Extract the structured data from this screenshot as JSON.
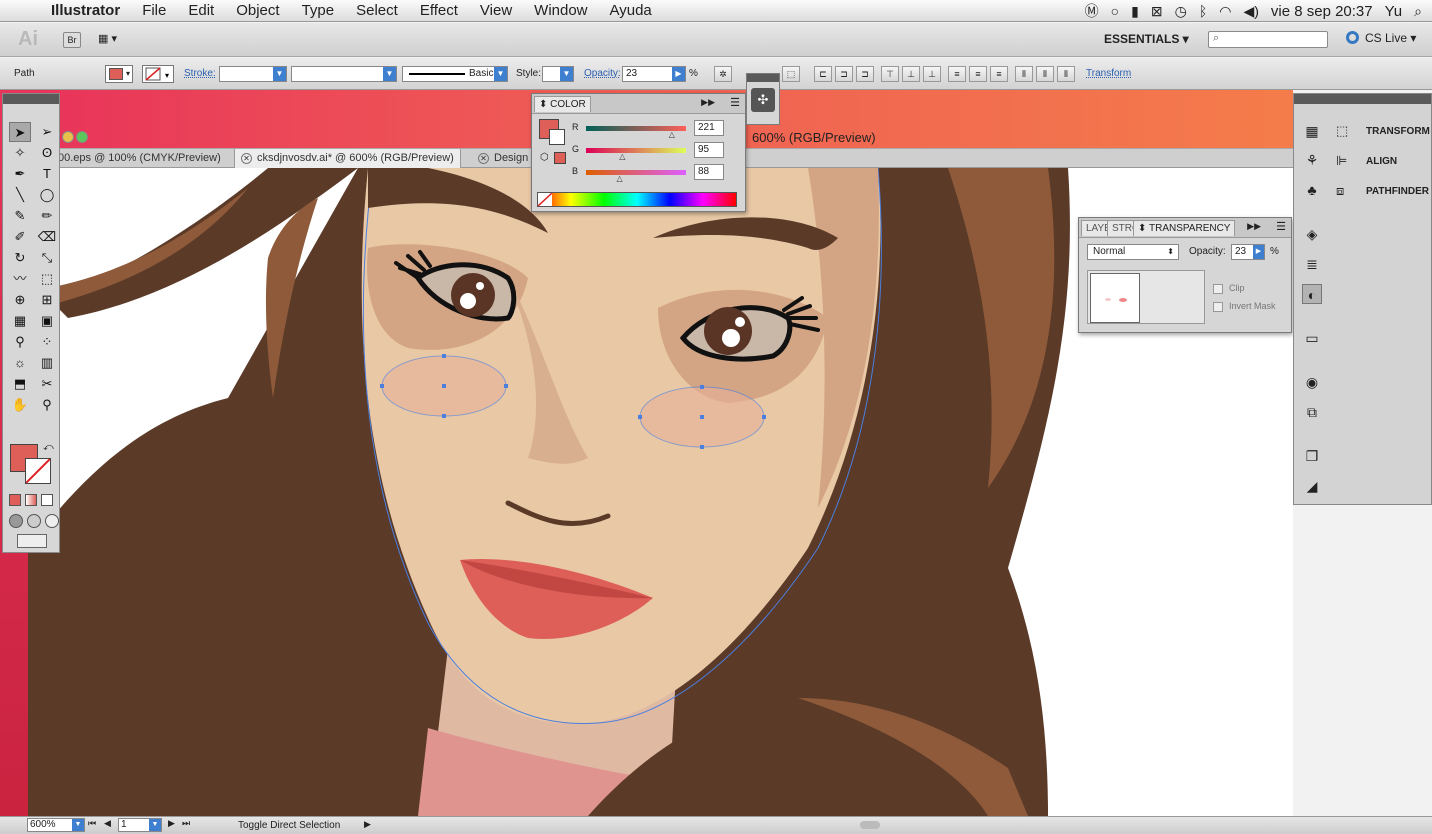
{
  "menubar": {
    "apple_icon": "apple-icon",
    "app_name": "Illustrator",
    "items": [
      "File",
      "Edit",
      "Object",
      "Type",
      "Select",
      "Effect",
      "View",
      "Window",
      "Ayuda"
    ],
    "clock": "vie 8 sep  20:37",
    "user": "Yu"
  },
  "appbar": {
    "logo": "Ai",
    "bridge": "Br",
    "workspace": "ESSENTIALS ▾",
    "search_placeholder": "",
    "cs_live": "CS Live ▾"
  },
  "control": {
    "selection_type": "Path",
    "stroke_label": "Stroke:",
    "brush_label": "Basic",
    "style_label": "Style:",
    "opacity_label": "Opacity:",
    "opacity_value": "23",
    "percent": "%",
    "transform_link": "Transform"
  },
  "tabs": [
    {
      "label": "00.eps @ 100% (CMYK/Preview)"
    },
    {
      "label": "cksdjnvosdv.ai* @ 600% (RGB/Preview)"
    },
    {
      "label": "Design"
    }
  ],
  "window_title_fragment": "600% (RGB/Preview)",
  "color_panel": {
    "title": "COLOR",
    "channels": [
      {
        "name": "R",
        "value": "221",
        "fraction": 0.867
      },
      {
        "name": "G",
        "value": "95",
        "fraction": 0.373
      },
      {
        "name": "B",
        "value": "88",
        "fraction": 0.345
      }
    ],
    "fill_color": "#dd5f58"
  },
  "transparency_panel": {
    "tabs": [
      "LAYE",
      "STRO",
      "TRANSPARENCY"
    ],
    "blend_mode": "Normal",
    "opacity_label": "Opacity:",
    "opacity_value": "23",
    "percent": "%",
    "clip_label": "Clip",
    "invert_mask_label": "Invert Mask"
  },
  "dock": {
    "items": [
      "TRANSFORM",
      "ALIGN",
      "PATHFINDER"
    ]
  },
  "status": {
    "zoom": "600%",
    "artboard": "1",
    "message": "Toggle Direct Selection"
  },
  "colors": {
    "hair": "#5b3a28",
    "hair_highlight": "#8e5a3a",
    "skin": "#e9c8a6",
    "skin_shadow": "#d3a585",
    "lips": "#dd5f58",
    "accent": "#3f7fd0",
    "header_gradient_start": "#e8335a",
    "header_gradient_end": "#f47c4a"
  }
}
